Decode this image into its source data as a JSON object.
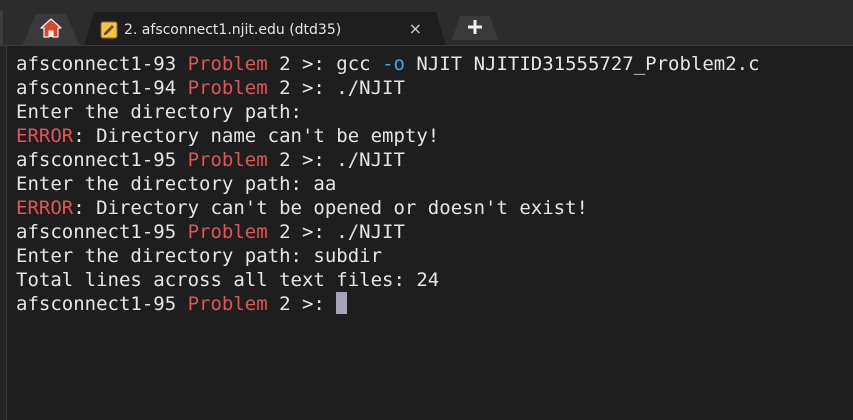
{
  "tabs": {
    "home_icon": "home-icon",
    "session_icon": "pencil-icon",
    "session_title": "2. afsconnect1.njit.edu (dtd35)",
    "close_symbol": "×",
    "new_tab_icon": "plus-icon"
  },
  "terminal": {
    "lines": [
      [
        {
          "t": "afsconnect1-93 "
        },
        {
          "t": "Problem",
          "c": "red"
        },
        {
          "t": " 2 >: gcc "
        },
        {
          "t": "-o",
          "c": "blue"
        },
        {
          "t": " NJIT NJITID31555727_Problem2.c"
        }
      ],
      [
        {
          "t": "afsconnect1-94 "
        },
        {
          "t": "Problem",
          "c": "red"
        },
        {
          "t": " 2 >: ./NJIT"
        }
      ],
      [
        {
          "t": "Enter the directory path:"
        }
      ],
      [
        {
          "t": "ERROR",
          "c": "red"
        },
        {
          "t": ": Directory name can't be empty!"
        }
      ],
      [
        {
          "t": "afsconnect1-95 "
        },
        {
          "t": "Problem",
          "c": "red"
        },
        {
          "t": " 2 >: ./NJIT"
        }
      ],
      [
        {
          "t": "Enter the directory path: aa"
        }
      ],
      [
        {
          "t": "ERROR",
          "c": "red"
        },
        {
          "t": ": Directory can't be opened or doesn't exist!"
        }
      ],
      [
        {
          "t": "afsconnect1-95 "
        },
        {
          "t": "Problem",
          "c": "red"
        },
        {
          "t": " 2 >: ./NJIT"
        }
      ],
      [
        {
          "t": "Enter the directory path: subdir"
        }
      ],
      [
        {
          "t": "Total lines across all text files: 24"
        }
      ],
      [
        {
          "t": "afsconnect1-95 "
        },
        {
          "t": "Problem",
          "c": "red"
        },
        {
          "t": " 2 >: "
        },
        {
          "cursor": true
        }
      ]
    ]
  },
  "colors": {
    "background": "#1e1e1e",
    "text": "#e6e6e6",
    "prompt_accent": "#e05555",
    "flag_accent": "#4aa0e6",
    "cursor": "#a8a3b8"
  }
}
